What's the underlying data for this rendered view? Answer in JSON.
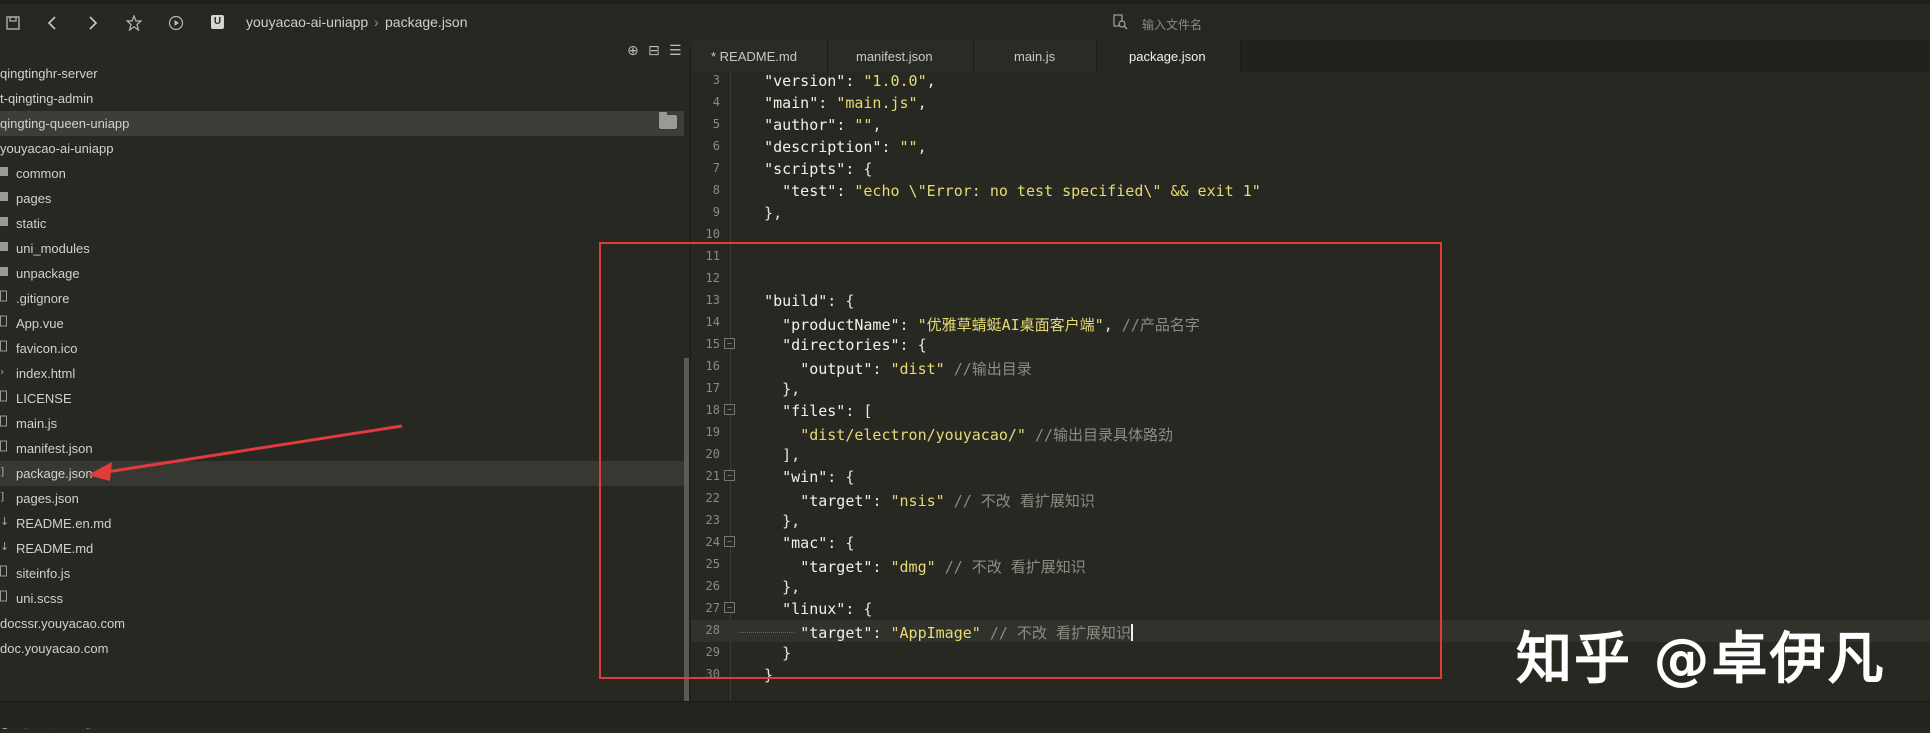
{
  "colors": {
    "accent_red": "#e23b3b",
    "key": "#f2f1e8",
    "string": "#e6db74",
    "comment": "#8c8c84",
    "punct": "#e6e6df",
    "folder": "#9a9a94"
  },
  "toolbar": {
    "icons": [
      "save-icon",
      "back-icon",
      "forward-icon",
      "star-icon",
      "run-icon"
    ],
    "breadcrumb": {
      "badge": "U",
      "project": "youyacao-ai-uniapp",
      "separator": "›",
      "file": "package.json"
    },
    "search_placeholder": "输入文件名"
  },
  "sidebar": {
    "tools": [
      "crosshair-icon",
      "collapse-icon",
      "menu-icon"
    ],
    "items": [
      {
        "label": "qingtinghr-server",
        "icon": "",
        "indent": 0
      },
      {
        "label": "t-qingting-admin",
        "icon": "",
        "indent": 0
      },
      {
        "label": "qingting-queen-uniapp",
        "icon": "",
        "indent": 0,
        "selected": true
      },
      {
        "label": "youyacao-ai-uniapp",
        "icon": "",
        "indent": 0
      },
      {
        "label": "common",
        "icon": "folder",
        "indent": 1
      },
      {
        "label": "pages",
        "icon": "folder",
        "indent": 1
      },
      {
        "label": "static",
        "icon": "folder",
        "indent": 1
      },
      {
        "label": "uni_modules",
        "icon": "folder",
        "indent": 1
      },
      {
        "label": "unpackage",
        "icon": "folder",
        "indent": 1
      },
      {
        "label": ".gitignore",
        "icon": "file",
        "indent": 1
      },
      {
        "label": "App.vue",
        "icon": "file",
        "indent": 1
      },
      {
        "label": "favicon.ico",
        "icon": "file",
        "indent": 1
      },
      {
        "label": "index.html",
        "icon": "code",
        "indent": 1
      },
      {
        "label": "LICENSE",
        "icon": "file",
        "indent": 1
      },
      {
        "label": "main.js",
        "icon": "file",
        "indent": 1
      },
      {
        "label": "manifest.json",
        "icon": "file",
        "indent": 1
      },
      {
        "label": "package.json",
        "icon": "bracket",
        "indent": 1,
        "active": true
      },
      {
        "label": "pages.json",
        "icon": "bracket",
        "indent": 1
      },
      {
        "label": "README.en.md",
        "icon": "md",
        "indent": 1
      },
      {
        "label": "README.md",
        "icon": "md",
        "indent": 1
      },
      {
        "label": "siteinfo.js",
        "icon": "file",
        "indent": 1
      },
      {
        "label": "uni.scss",
        "icon": "file",
        "indent": 1
      },
      {
        "label": "docssr.youyacao.com",
        "icon": "",
        "indent": 0
      },
      {
        "label": "doc.youyacao.com",
        "icon": "",
        "indent": 0
      }
    ],
    "bottom_tools": [
      "plugin-icon",
      "bug-icon",
      "refresh-icon",
      "settings-icon"
    ]
  },
  "tabs": [
    {
      "label": "* README.md",
      "active": false
    },
    {
      "label": "manifest.json",
      "active": false
    },
    {
      "label": "main.js",
      "active": false
    },
    {
      "label": "package.json",
      "active": true
    }
  ],
  "editor": {
    "lines": [
      {
        "n": "3",
        "fold": false,
        "tokens": [
          [
            "p",
            "  "
          ],
          [
            "k",
            "\"version\""
          ],
          [
            "p",
            ": "
          ],
          [
            "s",
            "\"1.0.0\""
          ],
          [
            "p",
            ","
          ]
        ]
      },
      {
        "n": "4",
        "fold": false,
        "tokens": [
          [
            "p",
            "  "
          ],
          [
            "k",
            "\"main\""
          ],
          [
            "p",
            ": "
          ],
          [
            "s",
            "\"main.js\""
          ],
          [
            "p",
            ","
          ]
        ]
      },
      {
        "n": "5",
        "fold": false,
        "tokens": [
          [
            "p",
            "  "
          ],
          [
            "k",
            "\"author\""
          ],
          [
            "p",
            ": "
          ],
          [
            "s",
            "\"\""
          ],
          [
            "p",
            ","
          ]
        ]
      },
      {
        "n": "6",
        "fold": false,
        "tokens": [
          [
            "p",
            "  "
          ],
          [
            "k",
            "\"description\""
          ],
          [
            "p",
            ": "
          ],
          [
            "s",
            "\"\""
          ],
          [
            "p",
            ","
          ]
        ]
      },
      {
        "n": "7",
        "fold": false,
        "tokens": [
          [
            "p",
            "  "
          ],
          [
            "k",
            "\"scripts\""
          ],
          [
            "p",
            ": {"
          ]
        ]
      },
      {
        "n": "8",
        "fold": false,
        "tokens": [
          [
            "p",
            "    "
          ],
          [
            "k",
            "\"test\""
          ],
          [
            "p",
            ": "
          ],
          [
            "s",
            "\"echo \\\"Error: no test specified\\\" && exit 1\""
          ]
        ]
      },
      {
        "n": "9",
        "fold": false,
        "tokens": [
          [
            "p",
            "  },"
          ]
        ]
      },
      {
        "n": "10",
        "fold": false,
        "tokens": []
      },
      {
        "n": "11",
        "fold": false,
        "tokens": []
      },
      {
        "n": "12",
        "fold": false,
        "tokens": []
      },
      {
        "n": "13",
        "fold": false,
        "tokens": [
          [
            "p",
            "  "
          ],
          [
            "k",
            "\"build\""
          ],
          [
            "p",
            ": {"
          ]
        ]
      },
      {
        "n": "14",
        "fold": false,
        "tokens": [
          [
            "p",
            "    "
          ],
          [
            "k",
            "\"productName\""
          ],
          [
            "p",
            ": "
          ],
          [
            "s",
            "\"优雅草蜻蜓AI桌面客户端\""
          ],
          [
            "p",
            ", "
          ],
          [
            "c",
            "//产品名字"
          ]
        ]
      },
      {
        "n": "15",
        "fold": true,
        "tokens": [
          [
            "p",
            "    "
          ],
          [
            "k",
            "\"directories\""
          ],
          [
            "p",
            ": {"
          ]
        ]
      },
      {
        "n": "16",
        "fold": false,
        "tokens": [
          [
            "p",
            "      "
          ],
          [
            "k",
            "\"output\""
          ],
          [
            "p",
            ": "
          ],
          [
            "s",
            "\"dist\""
          ],
          [
            "p",
            " "
          ],
          [
            "c",
            "//输出目录"
          ]
        ]
      },
      {
        "n": "17",
        "fold": false,
        "tokens": [
          [
            "p",
            "    },"
          ]
        ]
      },
      {
        "n": "18",
        "fold": true,
        "tokens": [
          [
            "p",
            "    "
          ],
          [
            "k",
            "\"files\""
          ],
          [
            "p",
            ": ["
          ]
        ]
      },
      {
        "n": "19",
        "fold": false,
        "tokens": [
          [
            "p",
            "      "
          ],
          [
            "s",
            "\"dist/electron/youyacao/\""
          ],
          [
            "p",
            " "
          ],
          [
            "c",
            "//输出目录具体路劲"
          ]
        ]
      },
      {
        "n": "20",
        "fold": false,
        "tokens": [
          [
            "p",
            "    ],"
          ]
        ]
      },
      {
        "n": "21",
        "fold": true,
        "tokens": [
          [
            "p",
            "    "
          ],
          [
            "k",
            "\"win\""
          ],
          [
            "p",
            ": {"
          ]
        ]
      },
      {
        "n": "22",
        "fold": false,
        "tokens": [
          [
            "p",
            "      "
          ],
          [
            "k",
            "\"target\""
          ],
          [
            "p",
            ": "
          ],
          [
            "s",
            "\"nsis\""
          ],
          [
            "p",
            " "
          ],
          [
            "c",
            "// 不改 看扩展知识"
          ]
        ]
      },
      {
        "n": "23",
        "fold": false,
        "tokens": [
          [
            "p",
            "    },"
          ]
        ]
      },
      {
        "n": "24",
        "fold": true,
        "tokens": [
          [
            "p",
            "    "
          ],
          [
            "k",
            "\"mac\""
          ],
          [
            "p",
            ": {"
          ]
        ]
      },
      {
        "n": "25",
        "fold": false,
        "tokens": [
          [
            "p",
            "      "
          ],
          [
            "k",
            "\"target\""
          ],
          [
            "p",
            ": "
          ],
          [
            "s",
            "\"dmg\""
          ],
          [
            "p",
            " "
          ],
          [
            "c",
            "// 不改 看扩展知识"
          ]
        ]
      },
      {
        "n": "26",
        "fold": false,
        "tokens": [
          [
            "p",
            "    },"
          ]
        ]
      },
      {
        "n": "27",
        "fold": true,
        "tokens": [
          [
            "p",
            "    "
          ],
          [
            "k",
            "\"linux\""
          ],
          [
            "p",
            ": {"
          ]
        ]
      },
      {
        "n": "28",
        "fold": false,
        "current": true,
        "tokens": [
          [
            "p",
            "      "
          ],
          [
            "k",
            "\"target\""
          ],
          [
            "p",
            ": "
          ],
          [
            "s",
            "\"AppImage\""
          ],
          [
            "p",
            " "
          ],
          [
            "c",
            "// 不改 看扩展知识"
          ]
        ]
      },
      {
        "n": "29",
        "fold": false,
        "tokens": [
          [
            "p",
            "    }"
          ]
        ]
      },
      {
        "n": "30",
        "fold": false,
        "tokens": [
          [
            "p",
            "  }"
          ]
        ]
      }
    ]
  },
  "watermark": "知乎 @卓伊凡"
}
